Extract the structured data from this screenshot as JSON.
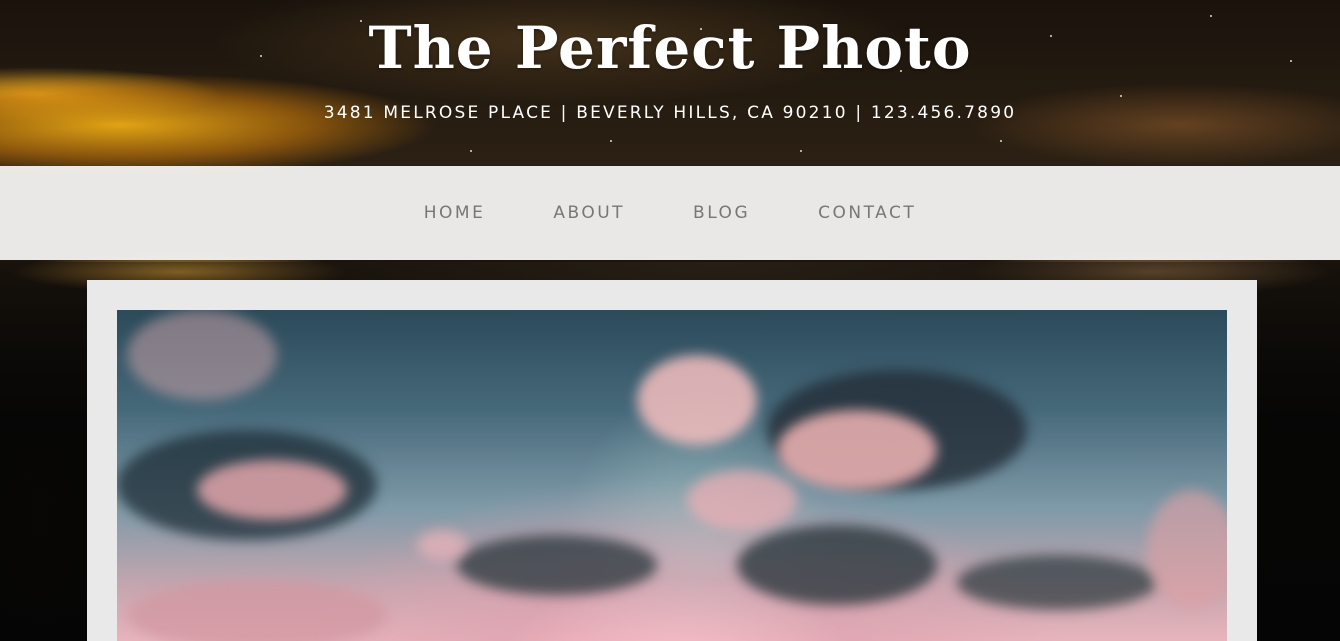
{
  "site": {
    "title": "The Perfect Photo",
    "info": "3481 MELROSE PLACE | BEVERLY HILLS, CA 90210 | 123.456.7890"
  },
  "nav": {
    "items": [
      {
        "label": "HOME"
      },
      {
        "label": "ABOUT"
      },
      {
        "label": "BLOG"
      },
      {
        "label": "CONTACT"
      }
    ]
  },
  "colors": {
    "nav_background": "#f4f3f2",
    "nav_text": "#777777",
    "title_text": "#ffffff",
    "panel_background": "#e9e9e9"
  },
  "hero": {
    "icon": "sunset-clouds-photo"
  }
}
